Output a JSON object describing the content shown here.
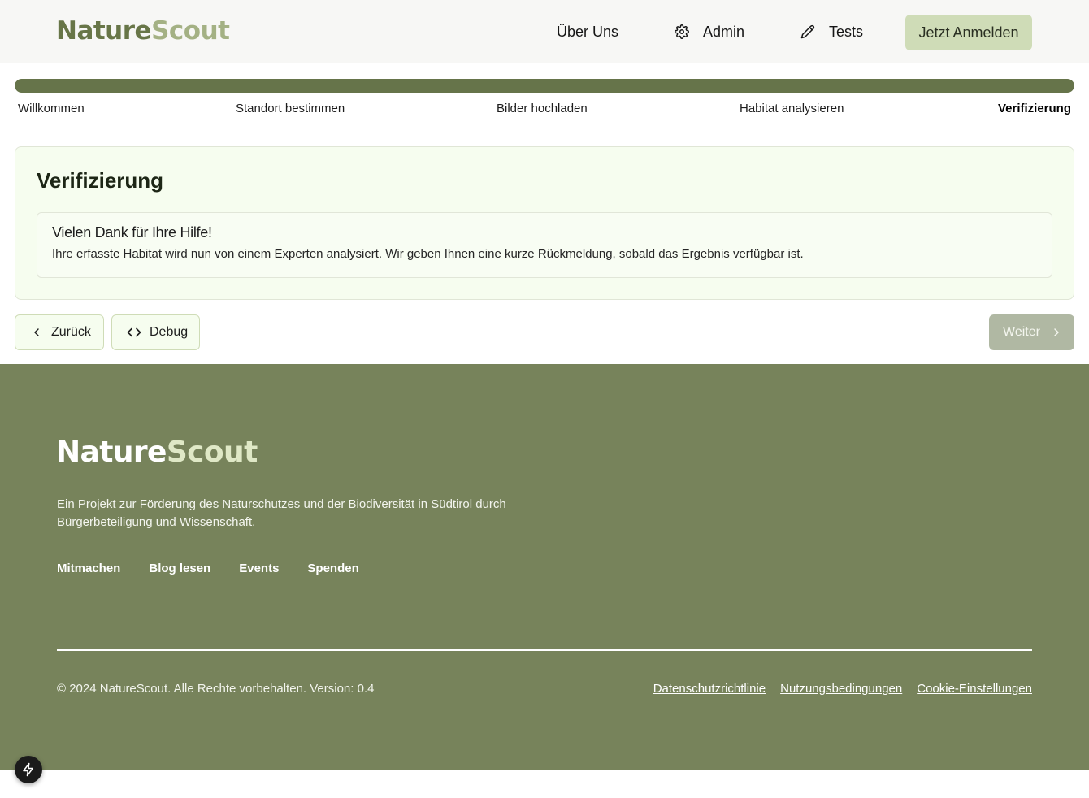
{
  "header": {
    "logo_part1": "Nature",
    "logo_part2": "Scout",
    "nav": {
      "about": "Über Uns",
      "admin": "Admin",
      "tests": "Tests"
    },
    "login_button": "Jetzt Anmelden"
  },
  "progress": {
    "value": 1.0,
    "steps": [
      "Willkommen",
      "Standort bestimmen",
      "Bilder hochladen",
      "Habitat analysieren",
      "Verifizierung"
    ],
    "active_step": "Verifizierung"
  },
  "card": {
    "title": "Verifizierung",
    "alert_title": "Vielen Dank für Ihre Hilfe!",
    "alert_text": "Ihre erfasste Habitat wird nun von einem Experten analysiert. Wir geben Ihnen eine kurze Rückmeldung, sobald das Ergebnis verfügbar ist."
  },
  "actions": {
    "back": "Zurück",
    "debug": "Debug",
    "next": "Weiter"
  },
  "footer": {
    "logo_part1": "Nature",
    "logo_part2": "Scout",
    "description": "Ein Projekt zur Förderung des Naturschutzes und der Biodiversität in Südtirol durch Bürgerbeteiligung und Wissenschaft.",
    "links": [
      "Mitmachen",
      "Blog lesen",
      "Events",
      "Spenden"
    ],
    "copyright": "© 2024 NatureScout. Alle Rechte vorbehalten. Version: 0.4",
    "legal": [
      "Datenschutzrichtlinie",
      "Nutzungsbedingungen",
      "Cookie-Einstellungen"
    ]
  },
  "colors": {
    "brand_dark": "#687648",
    "brand_light": "#a4b184",
    "footer_bg": "#77835b",
    "accent_button": "#cfdcb7",
    "card_bg": "#f6fdef"
  },
  "icons": {
    "admin": "gear-icon",
    "tests": "pencil-icon",
    "back": "chevron-left-icon",
    "debug": "code-icon",
    "next": "chevron-right-icon",
    "dev": "bolt-icon"
  }
}
